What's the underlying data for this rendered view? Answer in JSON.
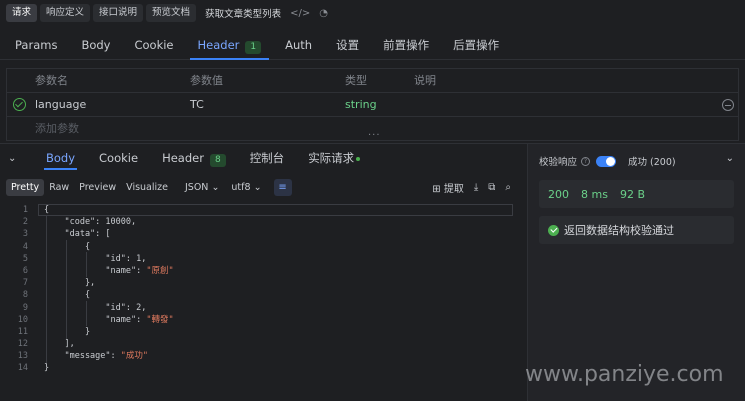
{
  "top_tabs": [
    "请求",
    "响应定义",
    "接口说明",
    "预览文档"
  ],
  "api_title": "获取文章类型列表",
  "request_tabs": [
    {
      "label": "Params"
    },
    {
      "label": "Body"
    },
    {
      "label": "Cookie"
    },
    {
      "label": "Header",
      "badge": "1"
    },
    {
      "label": "Auth"
    },
    {
      "label": "设置"
    },
    {
      "label": "前置操作"
    },
    {
      "label": "后置操作"
    }
  ],
  "params": {
    "headers": {
      "name": "参数名",
      "value": "参数值",
      "type": "类型",
      "desc": "说明"
    },
    "row": {
      "name": "language",
      "value": "TC",
      "type": "string"
    },
    "add_placeholder": "添加参数"
  },
  "response_tabs": [
    {
      "label": "Body"
    },
    {
      "label": "Cookie"
    },
    {
      "label": "Header",
      "badge": "8"
    },
    {
      "label": "控制台"
    },
    {
      "label": "实际请求"
    }
  ],
  "view_modes": [
    "Pretty",
    "Raw",
    "Preview",
    "Visualize"
  ],
  "format_select": "JSON",
  "encoding_select": "utf8",
  "extract_label": "提取",
  "code_lines": [
    "{",
    "    \"code\": 10000,",
    "    \"data\": [",
    "        {",
    "            \"id\": 1,",
    "            \"name\": \"原創\"",
    "        },",
    "        {",
    "            \"id\": 2,",
    "            \"name\": \"轉發\"",
    "        }",
    "    ],",
    "    \"message\": \"成功\"",
    "}"
  ],
  "validation": {
    "label": "校验响应",
    "result_label": "成功 (200)",
    "status_code": "200",
    "time": "8 ms",
    "size": "92 B",
    "pass_message": "返回数据结构校验通过"
  },
  "watermark": "www.panziye.com",
  "colors": {
    "accent": "#3b82f6",
    "success": "#4caf50",
    "string": "#e07a5f"
  }
}
